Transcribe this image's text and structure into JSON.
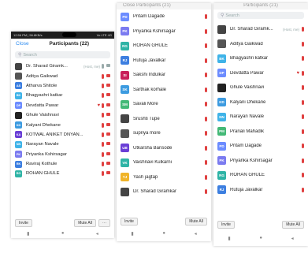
{
  "colors": {
    "accent": "#2d8cf0",
    "muted_red": "#e04040"
  },
  "p1": {
    "status_time": "12:56 PM | 56.8KB/s",
    "status_right": "Vo LTE 4G",
    "close": "Close",
    "title": "Participants (22)",
    "search_placeholder": "Search",
    "items": [
      {
        "initials": "",
        "name": "Dr. Sharad Giramk...",
        "tag": "(Host, me)",
        "color": "#444",
        "photo": true,
        "host": true
      },
      {
        "initials": "",
        "name": "Aditya Gaikwad",
        "color": "#555",
        "photo": true
      },
      {
        "initials": "AS",
        "name": "Atharva Shitole",
        "color": "#3d7fe0"
      },
      {
        "initials": "BK",
        "name": "Bhagyashri katkar",
        "color": "#3fb3e8"
      },
      {
        "initials": "DP",
        "name": "Devdatta Pawar",
        "color": "#6c8cff",
        "heart": true
      },
      {
        "initials": "",
        "name": "Ghule Vaishnavi",
        "color": "#222",
        "photo": true
      },
      {
        "initials": "KD",
        "name": "Kalyani Dhekane",
        "color": "#3d9be0"
      },
      {
        "initials": "KA",
        "name": "KOTWAL ANIKET DNYAN...",
        "color": "#6a3fd6"
      },
      {
        "initials": "NN",
        "name": "Narayan Navale",
        "color": "#3fb3e8"
      },
      {
        "initials": "PK",
        "name": "Priyanka Kshirsagar",
        "color": "#7b7bf0"
      },
      {
        "initials": "RK",
        "name": "Raviraj Kothule",
        "color": "#3d7fe0"
      },
      {
        "initials": "RG",
        "name": "ROHAN GHULE",
        "color": "#2fb4a6"
      }
    ],
    "invite": "Invite",
    "mute_all": "Mute All",
    "more": "···"
  },
  "p2": {
    "header_clip": "Close      Participants (21)",
    "items": [
      {
        "initials": "PD",
        "name": "Pritam Dagade",
        "color": "#6c8cff"
      },
      {
        "initials": "PK",
        "name": "Priyanka Kshirsagar",
        "color": "#7b7bf0"
      },
      {
        "initials": "RG",
        "name": "ROHAN GHULE",
        "color": "#2fb4a6"
      },
      {
        "initials": "RJ",
        "name": "Rutuja Javalkar",
        "color": "#3d7fe0"
      },
      {
        "initials": "SI",
        "name": "Sakshi Indulkar",
        "color": "#c81e5a"
      },
      {
        "initials": "SK",
        "name": "Sarthak korhale",
        "color": "#3d9be0"
      },
      {
        "initials": "SM",
        "name": "Savali More",
        "color": "#44b977"
      },
      {
        "initials": "",
        "name": "Srushti Tupe",
        "color": "#444",
        "photo": true
      },
      {
        "initials": "",
        "name": "supriya more",
        "color": "#555",
        "photo": true
      },
      {
        "initials": "UB",
        "name": "Utkarsha Bansode",
        "color": "#6a3fd6"
      },
      {
        "initials": "VK",
        "name": "Vaishnavi Kulkarni",
        "color": "#2fb4a6"
      },
      {
        "initials": "YJ",
        "name": "Yash jagtap",
        "color": "#f0b429"
      },
      {
        "initials": "",
        "name": "Dr. Sharad Giramkar",
        "color": "#444",
        "photo": true
      }
    ],
    "invite": "Invite",
    "mute_all": "Mute All"
  },
  "p3": {
    "header_clip": "Participants (21)",
    "search_placeholder": "Search",
    "items": [
      {
        "initials": "",
        "name": "Dr. Sharad Giramk...",
        "tag": "(Host, me)",
        "color": "#444",
        "photo": true
      },
      {
        "initials": "",
        "name": "Aditya Gaikwad",
        "color": "#555",
        "photo": true
      },
      {
        "initials": "BK",
        "name": "Bhagyashri katkar",
        "color": "#3fb3e8"
      },
      {
        "initials": "DP",
        "name": "Devdatta Pawar",
        "color": "#6c8cff",
        "heart": true
      },
      {
        "initials": "",
        "name": "Ghule Vaishnavi",
        "color": "#222",
        "photo": true
      },
      {
        "initials": "KD",
        "name": "Kalyani Dhekane",
        "color": "#3d9be0"
      },
      {
        "initials": "NN",
        "name": "Narayan Navale",
        "color": "#3fb3e8"
      },
      {
        "initials": "PM",
        "name": "Pranali Mahadik",
        "color": "#44b977"
      },
      {
        "initials": "PD",
        "name": "Pritam Dagade",
        "color": "#6c8cff"
      },
      {
        "initials": "PK",
        "name": "Priyanka Kshirsagar",
        "color": "#7b7bf0"
      },
      {
        "initials": "RG",
        "name": "ROHAN GHULE",
        "color": "#2fb4a6"
      },
      {
        "initials": "RJ",
        "name": "Rutuja Javalkar",
        "color": "#3d7fe0"
      }
    ],
    "invite": "Invite",
    "mute_all": "Mute All"
  }
}
